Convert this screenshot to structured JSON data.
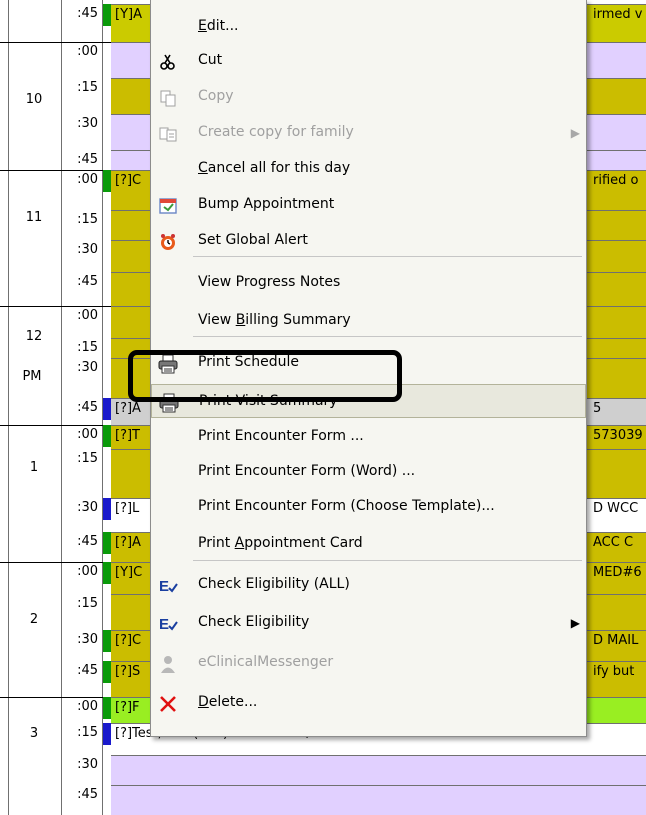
{
  "schedule": {
    "hours": [
      "10",
      "11",
      "12",
      "1",
      "2",
      "3"
    ],
    "pm_label": "PM",
    "rows": [
      {
        "minute": ":45",
        "color": "#cbcb00",
        "marker": "#0a9a0a",
        "text": "[Y]A",
        "tail": "irmed v"
      },
      {
        "minute": ":00",
        "color": "#e1d0ff",
        "marker": "",
        "text": "",
        "tail": ""
      },
      {
        "minute": ":15",
        "color": "#cbbd00",
        "marker": "",
        "text": "",
        "tail": ""
      },
      {
        "minute": ":30",
        "color": "#e1d0ff",
        "marker": "",
        "text": "",
        "tail": ""
      },
      {
        "minute": ":45",
        "color": "#e1d0ff",
        "marker": "",
        "text": "",
        "tail": ""
      },
      {
        "minute": ":00",
        "color": "#cbbd00",
        "marker": "#0a9a0a",
        "text": "[?]C",
        "tail": "rified o"
      },
      {
        "minute": ":15",
        "color": "#cbbd00",
        "marker": "",
        "text": "",
        "tail": ""
      },
      {
        "minute": ":30",
        "color": "#cbbd00",
        "marker": "",
        "text": "",
        "tail": ""
      },
      {
        "minute": ":45",
        "color": "#cbbd00",
        "marker": "",
        "text": "",
        "tail": ""
      },
      {
        "minute": ":00",
        "color": "#cbbd00",
        "marker": "",
        "text": "",
        "tail": ""
      },
      {
        "minute": ":15",
        "color": "#cbbd00",
        "marker": "",
        "text": "",
        "tail": ""
      },
      {
        "minute": ":30",
        "color": "#cbbd00",
        "marker": "",
        "text": "",
        "tail": ""
      },
      {
        "minute": ":45",
        "color": "#cfcfcf",
        "marker": "#1a1acc",
        "text": "[?]A",
        "tail": "5"
      },
      {
        "minute": ":00",
        "color": "#cbbd00",
        "marker": "#0a9a0a",
        "text": "[?]T",
        "tail": "573039"
      },
      {
        "minute": ":15",
        "color": "#cbbd00",
        "marker": "",
        "text": "",
        "tail": ""
      },
      {
        "minute": ":30",
        "color": "#ffffff",
        "marker": "#1a1acc",
        "text": "[?]L",
        "tail": "D WCC"
      },
      {
        "minute": ":45",
        "color": "#cbbd00",
        "marker": "#0a9a0a",
        "text": "[?]A",
        "tail": "ACC C"
      },
      {
        "minute": ":00",
        "color": "#cbbd00",
        "marker": "#0a9a0a",
        "text": "[Y]C",
        "tail": "MED#6"
      },
      {
        "minute": ":15",
        "color": "#cbbd00",
        "marker": "",
        "text": "",
        "tail": ""
      },
      {
        "minute": ":30",
        "color": "#cbbd00",
        "marker": "#0a9a0a",
        "text": "[?]C",
        "tail": "D MAIL"
      },
      {
        "minute": ":45",
        "color": "#cbbd00",
        "marker": "#0a9a0a",
        "text": "[?]S",
        "tail": "ify but"
      },
      {
        "minute": ":00",
        "color": "#99ee22",
        "marker": "#0a9a0a",
        "text": "[?]F",
        "tail": ""
      },
      {
        "minute": ":15",
        "color": "#ffffff",
        "marker": "#1a1acc",
        "text": "[?]Test,Pedi  (979) 456-7890   F/U PEN",
        "tail": ""
      },
      {
        "minute": ":30",
        "color": "#e1d0ff",
        "marker": "",
        "text": "",
        "tail": ""
      },
      {
        "minute": ":45",
        "color": "#e1d0ff",
        "marker": "",
        "text": "",
        "tail": ""
      }
    ]
  },
  "context_menu": {
    "items": [
      {
        "pre": "",
        "u": "E",
        "post": "dit...",
        "icon": "",
        "disabled": false,
        "submenu": false
      },
      {
        "pre": "Cut",
        "u": "",
        "post": "",
        "icon": "scissors-icon",
        "disabled": false,
        "submenu": false
      },
      {
        "pre": "Copy",
        "u": "",
        "post": "",
        "icon": "copy-icon",
        "disabled": true,
        "submenu": false
      },
      {
        "pre": "Create copy for family",
        "u": "",
        "post": "",
        "icon": "family-copy-icon",
        "disabled": true,
        "submenu": true
      },
      {
        "pre": "",
        "u": "C",
        "post": "ancel all for this day",
        "icon": "",
        "disabled": false,
        "submenu": false
      },
      {
        "pre": "Bump Appointment",
        "u": "",
        "post": "",
        "icon": "bump-appointment-icon",
        "disabled": false,
        "submenu": false
      },
      {
        "pre": "Set Global Alert",
        "u": "",
        "post": "",
        "icon": "global-alert-icon",
        "disabled": false,
        "submenu": false
      },
      {
        "pre": "View Progress Notes",
        "u": "",
        "post": "",
        "icon": "",
        "disabled": false,
        "submenu": false
      },
      {
        "pre": "View ",
        "u": "B",
        "post": "illing Summary",
        "icon": "",
        "disabled": false,
        "submenu": false
      },
      {
        "pre": "Print Schedule",
        "u": "",
        "post": "",
        "icon": "printer-icon",
        "disabled": false,
        "submenu": false
      },
      {
        "pre": "Print Visit Summary",
        "u": "",
        "post": "",
        "icon": "printer-icon",
        "disabled": false,
        "submenu": false
      },
      {
        "pre": "Print Encounter Form ...",
        "u": "",
        "post": "",
        "icon": "",
        "disabled": false,
        "submenu": false
      },
      {
        "pre": "Print Encounter Form (Word) ...",
        "u": "",
        "post": "",
        "icon": "",
        "disabled": false,
        "submenu": false
      },
      {
        "pre": "Print Encounter Form (Choose Template)...",
        "u": "",
        "post": "",
        "icon": "",
        "disabled": false,
        "submenu": false
      },
      {
        "pre": "Print ",
        "u": "A",
        "post": "ppointment Card",
        "icon": "",
        "disabled": false,
        "submenu": false
      },
      {
        "pre": "Check Eligibility (ALL)",
        "u": "",
        "post": "",
        "icon": "eligibility-icon",
        "disabled": false,
        "submenu": false
      },
      {
        "pre": "Check Eligibility",
        "u": "",
        "post": "",
        "icon": "eligibility-icon",
        "disabled": false,
        "submenu": true
      },
      {
        "pre": "eClinicalMessenger",
        "u": "",
        "post": "",
        "icon": "messenger-icon",
        "disabled": true,
        "submenu": false
      },
      {
        "pre": "",
        "u": "D",
        "post": "elete...",
        "icon": "delete-x-icon",
        "disabled": false,
        "submenu": false
      }
    ],
    "arrow_glyph": "▶",
    "highlighted_item": "Print Visit Summary"
  },
  "colors": {
    "callout_border": "#000000",
    "menu_background": "#f6f6f1"
  }
}
